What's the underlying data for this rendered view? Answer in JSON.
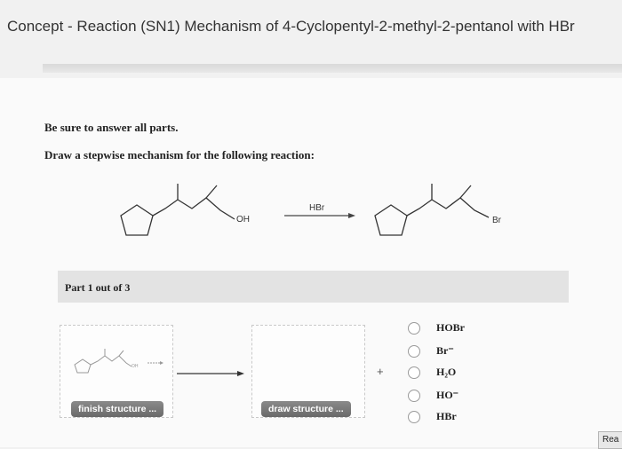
{
  "page": {
    "title": "Concept - Reaction (SN1) Mechanism of 4-Cyclopentyl-2-methyl-2-pentanol with HBr"
  },
  "question": {
    "instruction_1": "Be sure to answer all parts.",
    "instruction_2": "Draw a stepwise mechanism for the following reaction:",
    "reactant_oh_label": "OH",
    "reagent": "HBr",
    "product_br_label": "Br"
  },
  "part": {
    "label": "Part 1 out of 3"
  },
  "workspace": {
    "box1_oh_label": "OH",
    "finish_button": "finish structure ...",
    "draw_button": "draw structure ...",
    "plus": "+"
  },
  "options": [
    {
      "label": "HOBr",
      "selected": false
    },
    {
      "label": "Br⁻",
      "selected": false
    },
    {
      "label": "H₂O",
      "selected": false
    },
    {
      "label": "HO⁻",
      "selected": false
    },
    {
      "label": "HBr",
      "selected": false
    }
  ],
  "footer": {
    "cut_button": "Rea"
  }
}
